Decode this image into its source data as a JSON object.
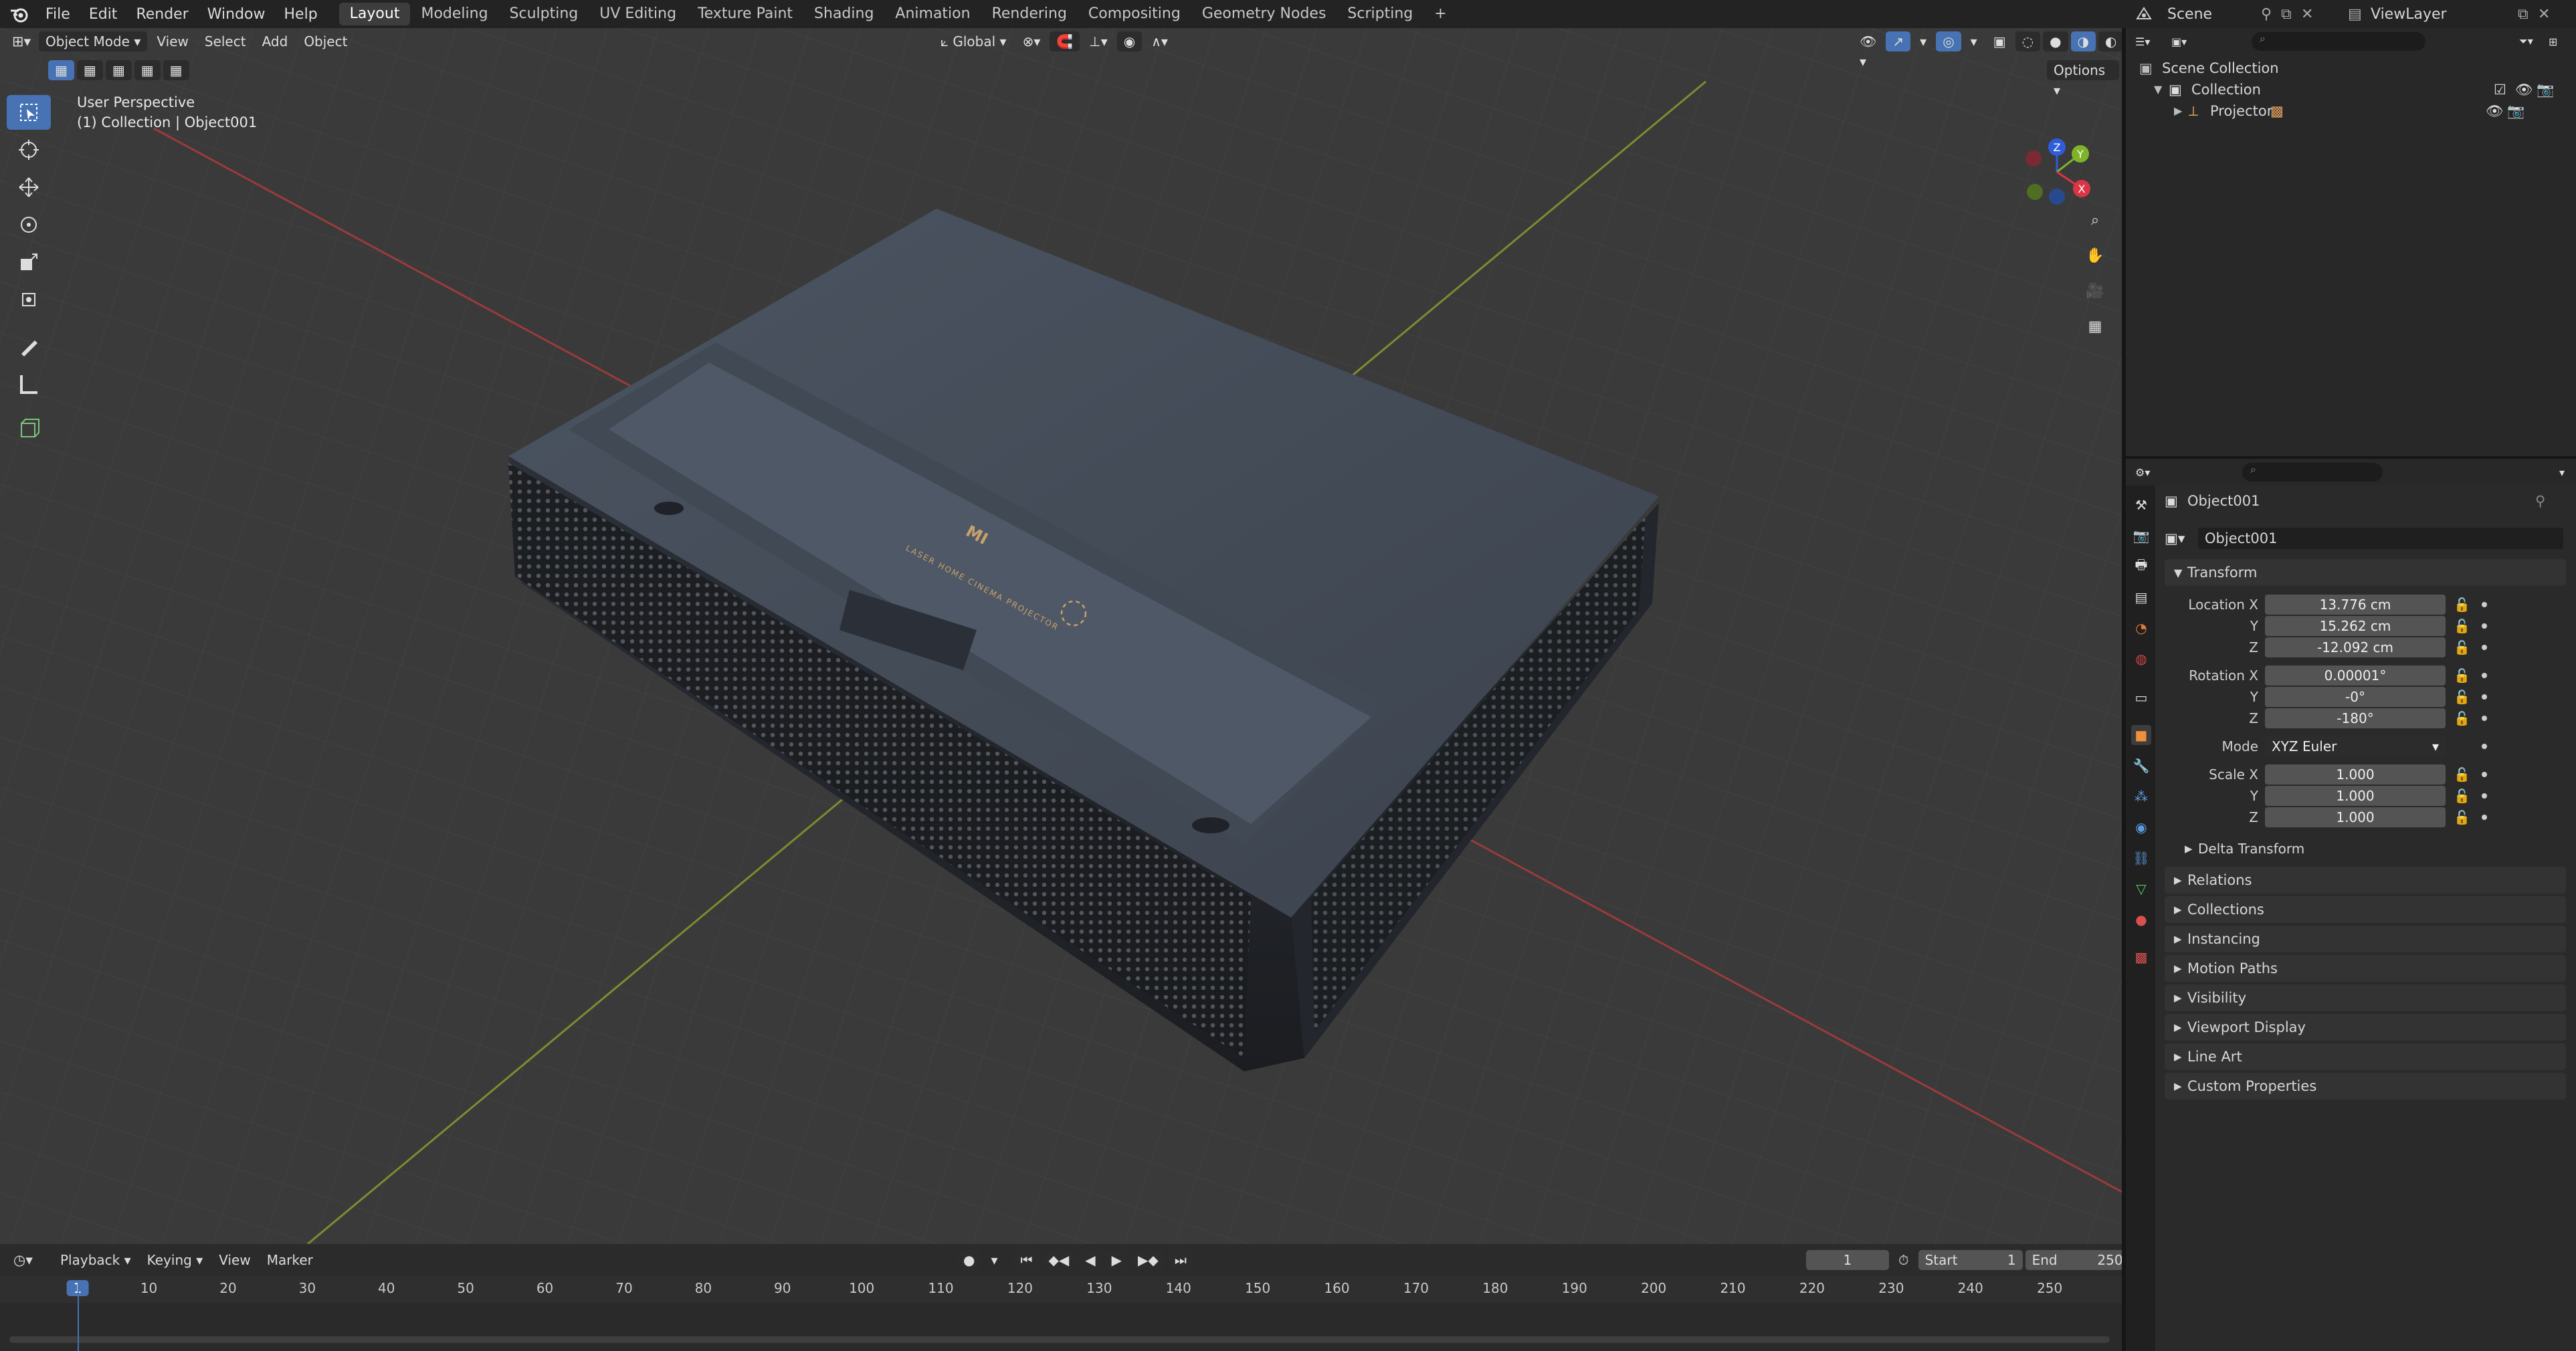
{
  "menus": [
    "File",
    "Edit",
    "Render",
    "Window",
    "Help"
  ],
  "workspaces": [
    "Layout",
    "Modeling",
    "Sculpting",
    "UV Editing",
    "Texture Paint",
    "Shading",
    "Animation",
    "Rendering",
    "Compositing",
    "Geometry Nodes",
    "Scripting",
    "+"
  ],
  "active_workspace": "Layout",
  "top_right": {
    "scene": "Scene",
    "view_layer": "ViewLayer"
  },
  "viewport": {
    "mode": "Object Mode",
    "menus": [
      "View",
      "Select",
      "Add",
      "Object"
    ],
    "orientation": "Global",
    "options": "Options",
    "overlay_line1": "User Perspective",
    "overlay_line2": "(1) Collection | Object001",
    "model_logo": "MI",
    "model_text": "LASER HOME CINEMA PROJECTOR",
    "gizmo": {
      "z": "Z",
      "y": "Y",
      "x": "X"
    }
  },
  "outliner": {
    "scene_collection": "Scene Collection",
    "collection": "Collection",
    "object": "Projector"
  },
  "properties": {
    "object_name": "Object001",
    "data_name": "Object001",
    "transform_label": "Transform",
    "location_label": "Location X",
    "rotation_label": "Rotation X",
    "scale_label": "Scale X",
    "y_label": "Y",
    "z_label": "Z",
    "mode_label": "Mode",
    "mode_value": "XYZ Euler",
    "location": [
      "13.776 cm",
      "15.262 cm",
      "-12.092 cm"
    ],
    "rotation": [
      "0.00001°",
      "-0°",
      "-180°"
    ],
    "scale": [
      "1.000",
      "1.000",
      "1.000"
    ],
    "delta_transform": "Delta Transform",
    "panels": [
      "Relations",
      "Collections",
      "Instancing",
      "Motion Paths",
      "Visibility",
      "Viewport Display",
      "Line Art",
      "Custom Properties"
    ]
  },
  "timeline": {
    "menus": [
      "Playback",
      "Keying",
      "View",
      "Marker"
    ],
    "current_frame": "1",
    "start_label": "Start",
    "start": "1",
    "end_label": "End",
    "end": "250",
    "ticks": [
      "1",
      "10",
      "20",
      "30",
      "40",
      "50",
      "60",
      "70",
      "80",
      "90",
      "100",
      "110",
      "120",
      "130",
      "140",
      "150",
      "160",
      "170",
      "180",
      "190",
      "200",
      "210",
      "220",
      "230",
      "240",
      "250"
    ]
  }
}
